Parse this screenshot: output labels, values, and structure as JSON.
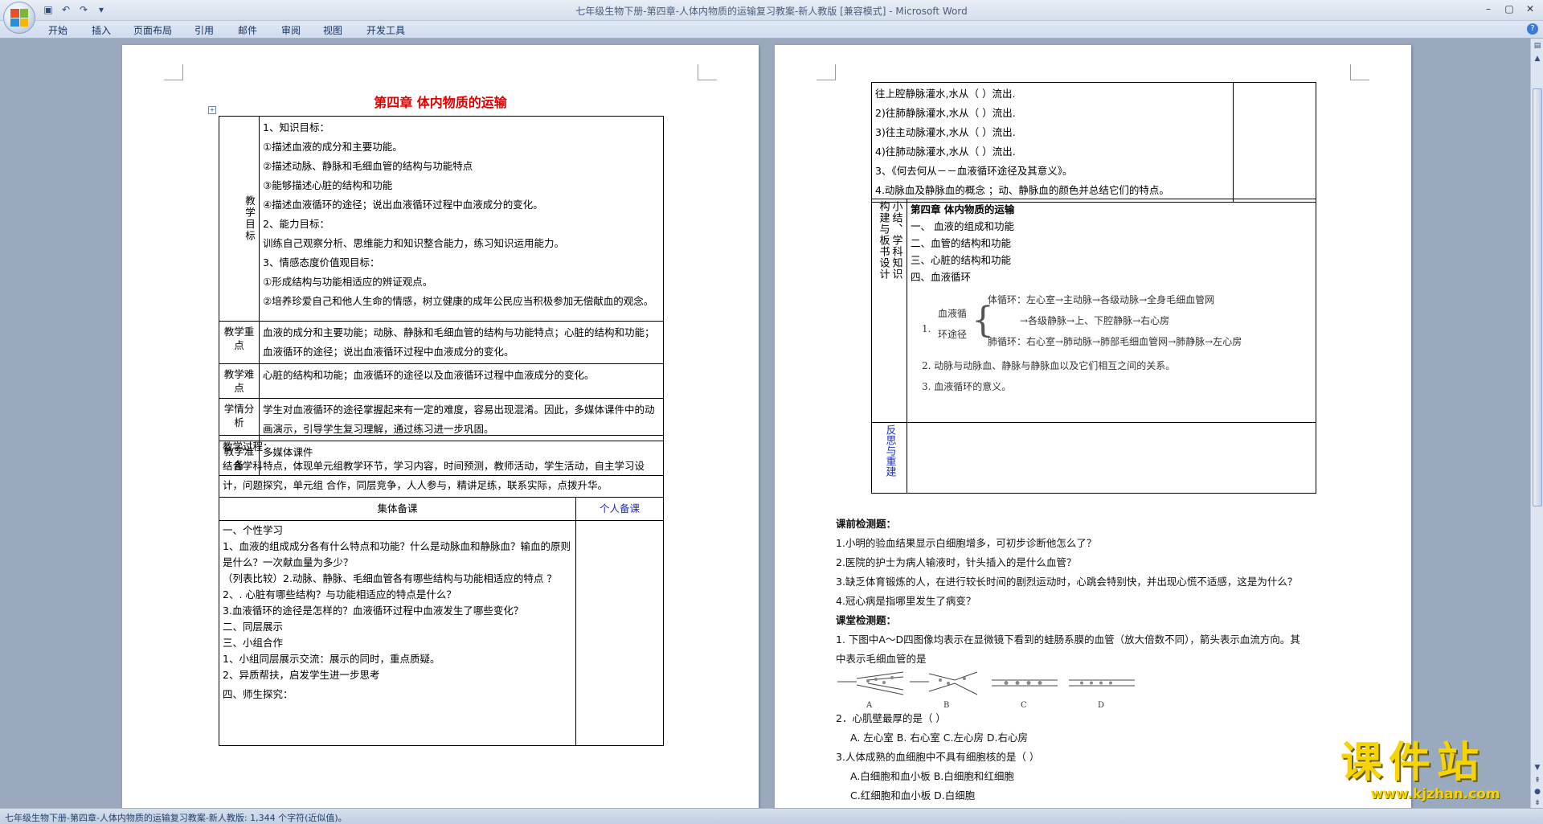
{
  "window": {
    "title": "七年级生物下册-第四章-人体内物质的运输复习教案-新人教版 [兼容模式] - Microsoft Word"
  },
  "ribbon": {
    "tabs": [
      "开始",
      "插入",
      "页面布局",
      "引用",
      "邮件",
      "审阅",
      "视图",
      "开发工具"
    ]
  },
  "status": {
    "text": "七年级生物下册-第四章-人体内物质的运输复习教案-新人教版: 1,344 个字符(近似值)。"
  },
  "page1": {
    "title": "第四章  体内物质的运输",
    "rows": [
      {
        "label": "教学目标",
        "lines": [
          "1、知识目标：",
          "①描述血液的成分和主要功能。",
          "②描述动脉、静脉和毛细血管的结构与功能特点",
          "③能够描述心脏的结构和功能",
          "④描述血液循环的途径；说出血液循环过程中血液成分的变化。",
          "2、能力目标：",
          "训练自己观察分析、思维能力和知识整合能力，练习知识运用能力。",
          "3、情感态度价值观目标：",
          "①形成结构与功能相适应的辨证观点。",
          "②培养珍爱自己和他人生命的情感，树立健康的成年公民应当积极参加无偿献血的观念。"
        ]
      },
      {
        "label": "教学重点",
        "text": "血液的成分和主要功能；动脉、静脉和毛细血管的结构与功能特点；心脏的结构和功能；血液循环的途径；说出血液循环过程中血液成分的变化。"
      },
      {
        "label": "教学难点",
        "text": "心脏的结构和功能；血液循环的途径以及血液循环过程中血液成分的变化。"
      },
      {
        "label": "学情分析",
        "text": "学生对血液循环的途径掌握起来有一定的难度，容易出现混淆。因此，多媒体课件中的动画演示，引导学生复习理解，通过练习进一步巩固。"
      },
      {
        "label": "教学准备",
        "text": "多媒体课件"
      }
    ],
    "process_title": "教学过程：",
    "process_text": "结合学科特点，体现单元组教学环节，学习内容，时间预测，教师活动，学生活动，自主学习设计，问题探究，单元组 合作，同层竞争，人人参与，精讲足练，联系实际，点拨升华。",
    "col_collective": "集体备课",
    "col_personal": "个人备课",
    "steps": [
      "一、个性学习",
      "1、血液的组成成分各有什么特点和功能？什么是动脉血和静脉血？输血的原则是什么？一次献血量为多少？",
      "（列表比较）2.动脉、静脉、毛细血管各有哪些结构与功能相适应的特点 ？",
      "2、. 心脏有哪些结构？与功能相适应的特点是什么？",
      "3.血液循环的途径是怎样的？血液循环过程中血液发生了哪些变化？",
      "二、同层展示",
      "三、小组合作",
      "1、小组同层展示交流：展示的同时，重点质疑。",
      "2、异质帮扶，启发学生进一步思考",
      "四、师生探究："
    ]
  },
  "page2": {
    "top_lines": [
      "往上腔静脉灌水,水从（                    ）流出.",
      "2)往肺静脉灌水,水从（                    ）流出.",
      "3)往主动脉灌水,水从（                    ）流出.",
      "4)往肺动脉灌水,水从（                    ）流出.",
      "3、《何去何从－－血液循环途径及其意义》。",
      "4.动脉血及静脉血的概念 ；动、静脉血的颜色并总结它们的特点。"
    ],
    "summary_label_a": "构建与板书设计",
    "summary_label_b": "小结、学科知识",
    "summary_title": "第四章   体内物质的运输",
    "summary_items": [
      "一、 血液的组成和功能",
      "二、血管的结构和功能",
      "三、心脏的结构和功能",
      "四、血液循环"
    ],
    "diagram": {
      "num": "1.",
      "path_label": "血液循环途径",
      "systemic": "体循环：左心室→主动脉→各级动脉→全身毛细血管网",
      "middle": "→各级静脉→上、下腔静脉→右心房",
      "pulmonary": "肺循环：右心室→肺动脉→肺部毛细血管网→肺静脉→左心房",
      "item2": "2.   动脉与动脉血、静脉与静脉血以及它们相互之间的关系。",
      "item3": "3.   血液循环的意义。"
    },
    "reflect_label": "反思与重建",
    "pre_test_title": "课前检测题：",
    "pre_test": [
      "1.小明的验血结果显示白细胞增多，可初步诊断他怎么了？",
      "2.医院的护士为病人输液时，针头插入的是什么血管？",
      "3.缺乏体育锻炼的人，在进行较长时间的剧烈运动时，心跳会特别快，并出现心慌不适感，这是为什么？",
      "4.冠心病是指哪里发生了病变？"
    ],
    "class_test_title": "课堂检测题：",
    "q1_line1": "1. 下图中A～D四图像均表示在显微镜下看到的蛙肠系膜的血管（放大倍数不同），箭头表示血流方向。其",
    "q1_line2": "中表示毛细血管的是",
    "fig_labels": [
      "A",
      "B",
      "C",
      "D"
    ],
    "q2": "2．心肌壁最厚的是（        ）",
    "q2_opts": "A. 左心室  B. 右心室   C.左心房   D.右心房",
    "q3": "3.人体成熟的血细胞中不具有细胞核的是（          ）",
    "q3_opts1": "A.白细胞和血小板        B.白细胞和红细胞",
    "q3_opts2": "C.红细胞和血小板        D.白细胞"
  },
  "watermark": {
    "main": "课件站",
    "sub": "www.kjzhan.com"
  }
}
